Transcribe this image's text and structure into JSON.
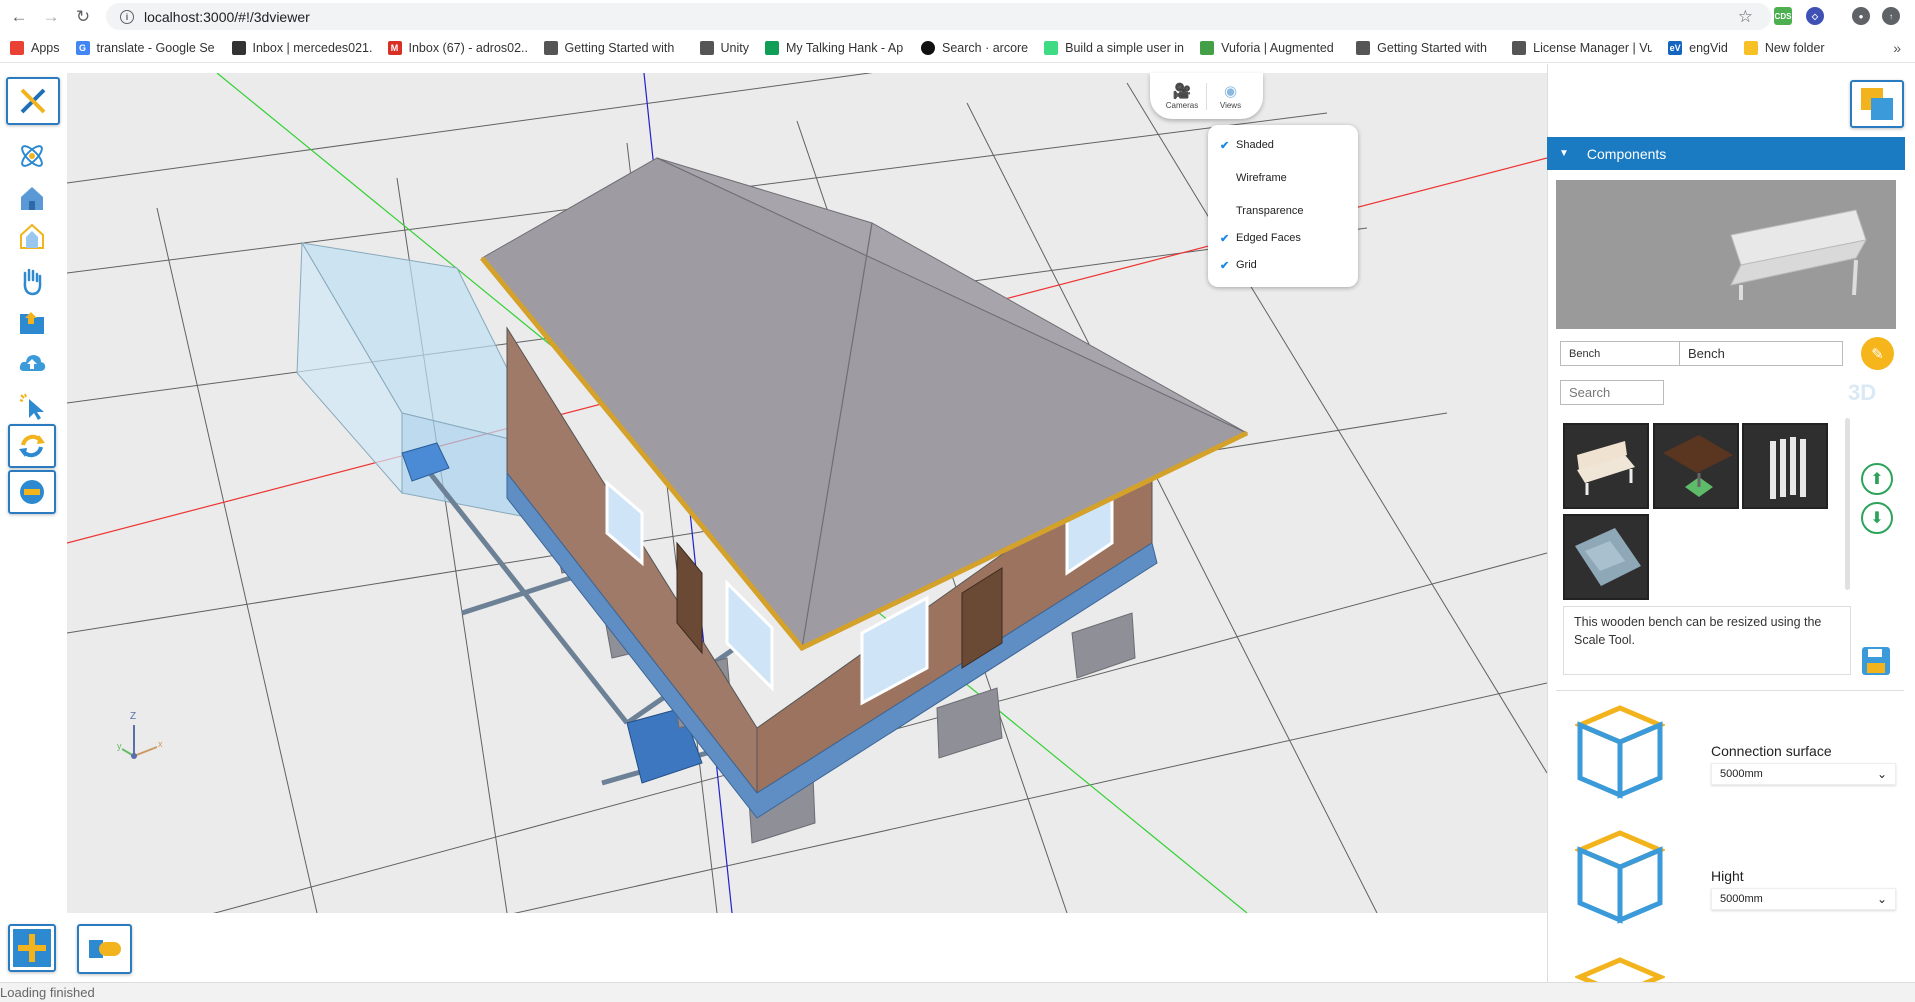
{
  "browser": {
    "url": "localhost:3000/#!/3dviewer",
    "bookmarks": [
      {
        "label": "Apps",
        "color": "#e94235"
      },
      {
        "label": "translate - Google Se",
        "color": "#4285f4"
      },
      {
        "label": "Inbox | mercedes021...",
        "color": "#333333"
      },
      {
        "label": "Inbox (67) - adros02...",
        "color": "#d93025"
      },
      {
        "label": "Getting Started with",
        "color": "#555555"
      },
      {
        "label": "Unity",
        "color": "#555555"
      },
      {
        "label": "My Talking Hank - Ap",
        "color": "#0f9d58"
      },
      {
        "label": "Search · arcore",
        "color": "#111111"
      },
      {
        "label": "Build a simple user in",
        "color": "#3ddc84"
      },
      {
        "label": "Vuforia | Augmented",
        "color": "#43a047"
      },
      {
        "label": "Getting Started with",
        "color": "#555555"
      },
      {
        "label": "License Manager | Vu",
        "color": "#555555"
      },
      {
        "label": "engVid",
        "color": "#1565c0"
      },
      {
        "label": "New folder",
        "color": "#f6c026"
      }
    ]
  },
  "views_pill": {
    "cameras_label": "Cameras",
    "views_label": "Views"
  },
  "views_menu": {
    "items": [
      {
        "label": "Shaded",
        "checked": "✔"
      },
      {
        "label": "Wireframe",
        "checked": ""
      },
      {
        "label": "Transparence",
        "checked": ""
      },
      {
        "label": "Edged Faces",
        "checked": "✔"
      },
      {
        "label": "Grid",
        "checked": "✔"
      }
    ]
  },
  "panel": {
    "title": "Components",
    "category_select": "Bench",
    "name_field": "Bench",
    "search_placeholder": "Search",
    "watermark": "3D",
    "description": "This wooden bench can be resized using the Scale Tool.",
    "params": [
      {
        "label": "Connection surface",
        "value": "5000mm"
      },
      {
        "label": "Hight",
        "value": "5000mm"
      }
    ]
  },
  "axis": {
    "x": "x",
    "y": "y",
    "z": "Z"
  },
  "status": "Loading finished",
  "colors": {
    "accent": "#1a7bc3",
    "viewport": "#ebebeb",
    "roof": "#9e9ca2",
    "wall": "#9c7866",
    "base": "#5f8ec4"
  }
}
